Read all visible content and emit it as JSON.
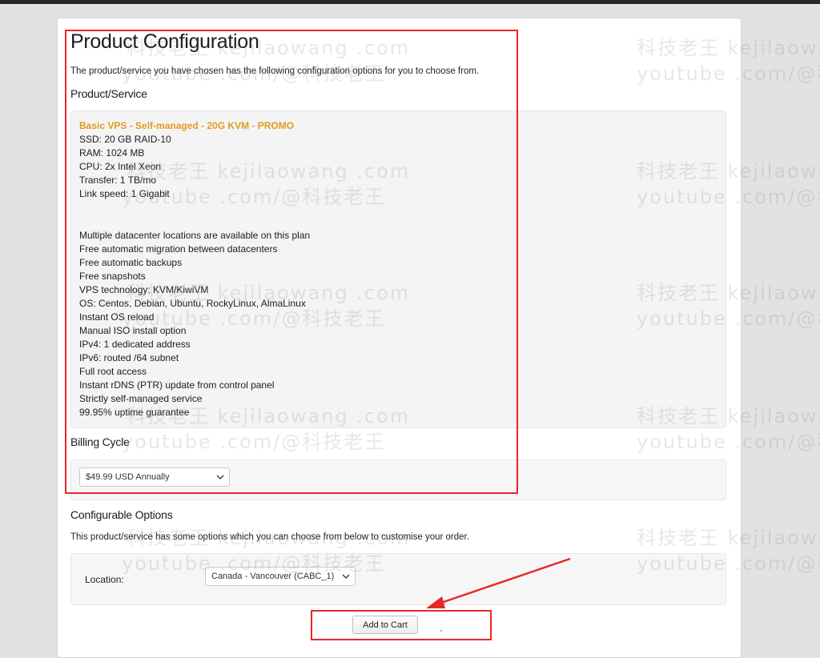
{
  "page": {
    "title": "Product Configuration",
    "intro": "The product/service you have chosen has the following configuration options for you to choose from."
  },
  "product_section": {
    "heading": "Product/Service",
    "product_name": "Basic VPS - Self-managed - 20G KVM - PROMO",
    "specs": [
      "SSD: 20 GB RAID-10",
      "RAM: 1024 MB",
      "CPU: 2x Intel Xeon",
      "Transfer: 1 TB/mo",
      "Link speed: 1 Gigabit"
    ],
    "features": [
      "Multiple datacenter locations are available on this plan",
      "Free automatic migration between datacenters",
      "Free automatic backups",
      "Free snapshots",
      "VPS technology: KVM/KiwiVM",
      "OS: Centos, Debian, Ubuntu, RockyLinux, AlmaLinux",
      "Instant OS reload",
      "Manual ISO install option",
      "IPv4: 1 dedicated address",
      "IPv6: routed /64 subnet",
      "Full root access",
      "Instant rDNS (PTR) update from control panel",
      "Strictly self-managed service",
      "99.95% uptime guarantee"
    ]
  },
  "billing": {
    "heading": "Billing Cycle",
    "selected": "$49.99 USD Annually"
  },
  "configurable_options": {
    "heading": "Configurable Options",
    "description": "This product/service has some options which you can choose from below to customise your order.",
    "location_label": "Location:",
    "location_selected": "Canada - Vancouver (CABC_1)"
  },
  "actions": {
    "add_to_cart": "Add to Cart"
  },
  "watermark": {
    "line1": "科技老王 kejilaowang .com",
    "line2": "youtube .com/@科技老王"
  },
  "colors": {
    "product_name": "#e29a1f",
    "highlight": "#e8272b",
    "top_bar": "#2b2623"
  }
}
